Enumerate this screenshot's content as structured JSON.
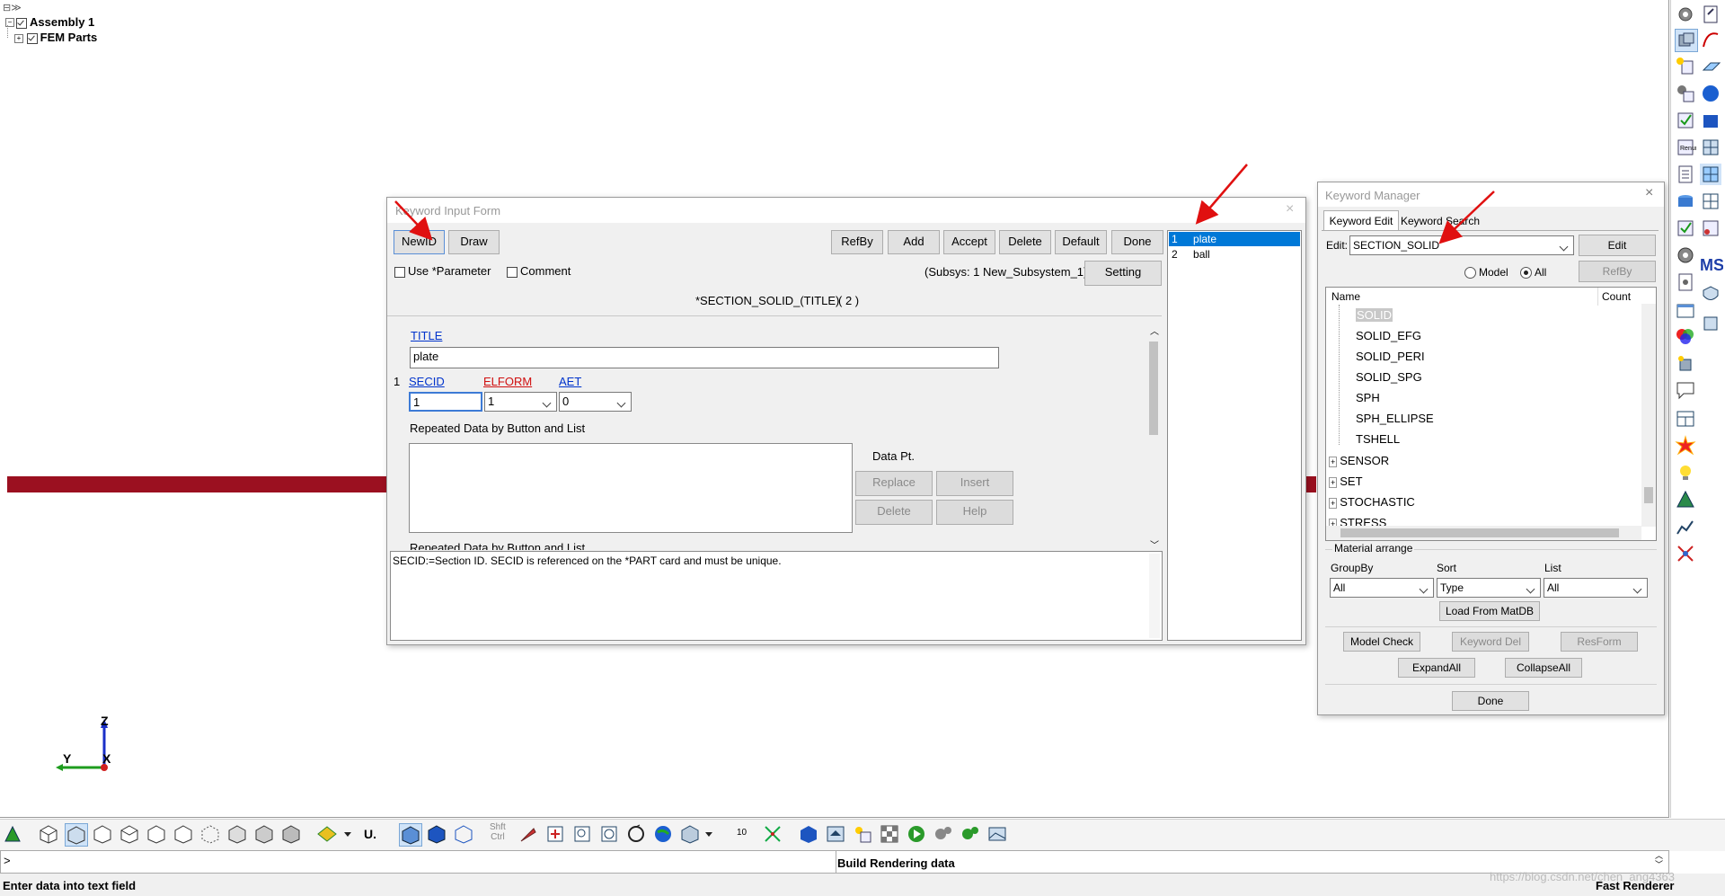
{
  "tree": {
    "root_label": "Assembly 1",
    "child_label": "FEM Parts"
  },
  "axes": {
    "z": "Z",
    "y": "Y",
    "x": "X"
  },
  "kif": {
    "title": "Keyword Input Form",
    "buttons": {
      "newid": "NewID",
      "draw": "Draw",
      "refby": "RefBy",
      "add": "Add",
      "accept": "Accept",
      "delete": "Delete",
      "default": "Default",
      "done": "Done",
      "setting": "Setting"
    },
    "use_param": "Use *Parameter",
    "comment": "Comment",
    "subsys": "(Subsys: 1 New_Subsystem_1)",
    "keyword_header": "*SECTION_SOLID_(TITLE)",
    "count": "( 2 )",
    "title_label": "TITLE",
    "title_value": "plate",
    "row_index": "1",
    "secid_label": "SECID",
    "elform_label": "ELFORM",
    "aet_label": "AET",
    "secid_value": "1",
    "elform_value": "1",
    "aet_value": "0",
    "repeated_label": "Repeated Data by Button and List",
    "data_pt": "Data Pt.",
    "replace": "Replace",
    "insert": "Insert",
    "delete2": "Delete",
    "help": "Help",
    "repeated_label2": "Repeated Data by Button and List",
    "help_text": "SECID:=Section ID. SECID is referenced on the *PART card and must be unique.",
    "list": [
      {
        "num": "1",
        "name": "plate"
      },
      {
        "num": "2",
        "name": "ball"
      }
    ]
  },
  "km": {
    "title": "Keyword Manager",
    "tab_edit": "Keyword Edit",
    "tab_search": "Keyword Search",
    "edit_label": "Edit:",
    "edit_value": "SECTION_SOLID",
    "edit_button": "Edit",
    "model_label": "Model",
    "all_label": "All",
    "refby": "RefBy",
    "col_name": "Name",
    "col_count": "Count",
    "items": [
      "SOLID",
      "SOLID_EFG",
      "SOLID_PERI",
      "SOLID_SPG",
      "SPH",
      "SPH_ELLIPSE",
      "TSHELL"
    ],
    "groups": [
      "SENSOR",
      "SET",
      "STOCHASTIC",
      "STRESS"
    ],
    "material_arrange": "Material arrange",
    "groupby_label": "GroupBy",
    "sort_label": "Sort",
    "list_label": "List",
    "groupby_value": "All",
    "sort_value": "Type",
    "list_value": "All",
    "load_matdb": "Load From MatDB",
    "model_check": "Model Check",
    "keyword_del": "Keyword Del",
    "resform": "ResForm",
    "expand_all": "ExpandAll",
    "collapse_all": "CollapseAll",
    "done": "Done"
  },
  "toolbar": {
    "u_label": "U.",
    "shft_label": "Shft",
    "ctrl_label": "Ctrl",
    "ten_label": "10"
  },
  "cmd": {
    "prompt": ">",
    "status_left": "Enter data into text field",
    "status_mid": "Build Rendering data",
    "status_right": "Fast Renderer",
    "watermark": "https://blog.csdn.net/chen_ang4363"
  }
}
